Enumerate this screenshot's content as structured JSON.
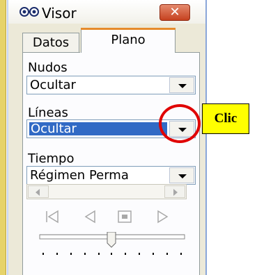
{
  "window": {
    "title": "Visor",
    "close_glyph": "✕",
    "title_icon": "glasses-icon"
  },
  "tabs": [
    {
      "label": "Datos",
      "active": false
    },
    {
      "label": "Plano",
      "active": true
    }
  ],
  "panel": {
    "nudos": {
      "label": "Nudos",
      "value": "Ocultar"
    },
    "lineas": {
      "label": "Líneas",
      "value": "Ocultar",
      "selected": true
    },
    "tiempo": {
      "label": "Tiempo",
      "value": "Régimen Perma"
    }
  },
  "media_controls": [
    "first-frame-icon",
    "previous-icon",
    "stop-icon",
    "play-icon"
  ],
  "annotation": {
    "text": "Clic",
    "box_color": "#ffff00",
    "circle_color": "#e00000"
  },
  "colors": {
    "selection": "#316ac5",
    "window_bg": "#ece9d8",
    "tab_highlight": "#e68b2c"
  }
}
